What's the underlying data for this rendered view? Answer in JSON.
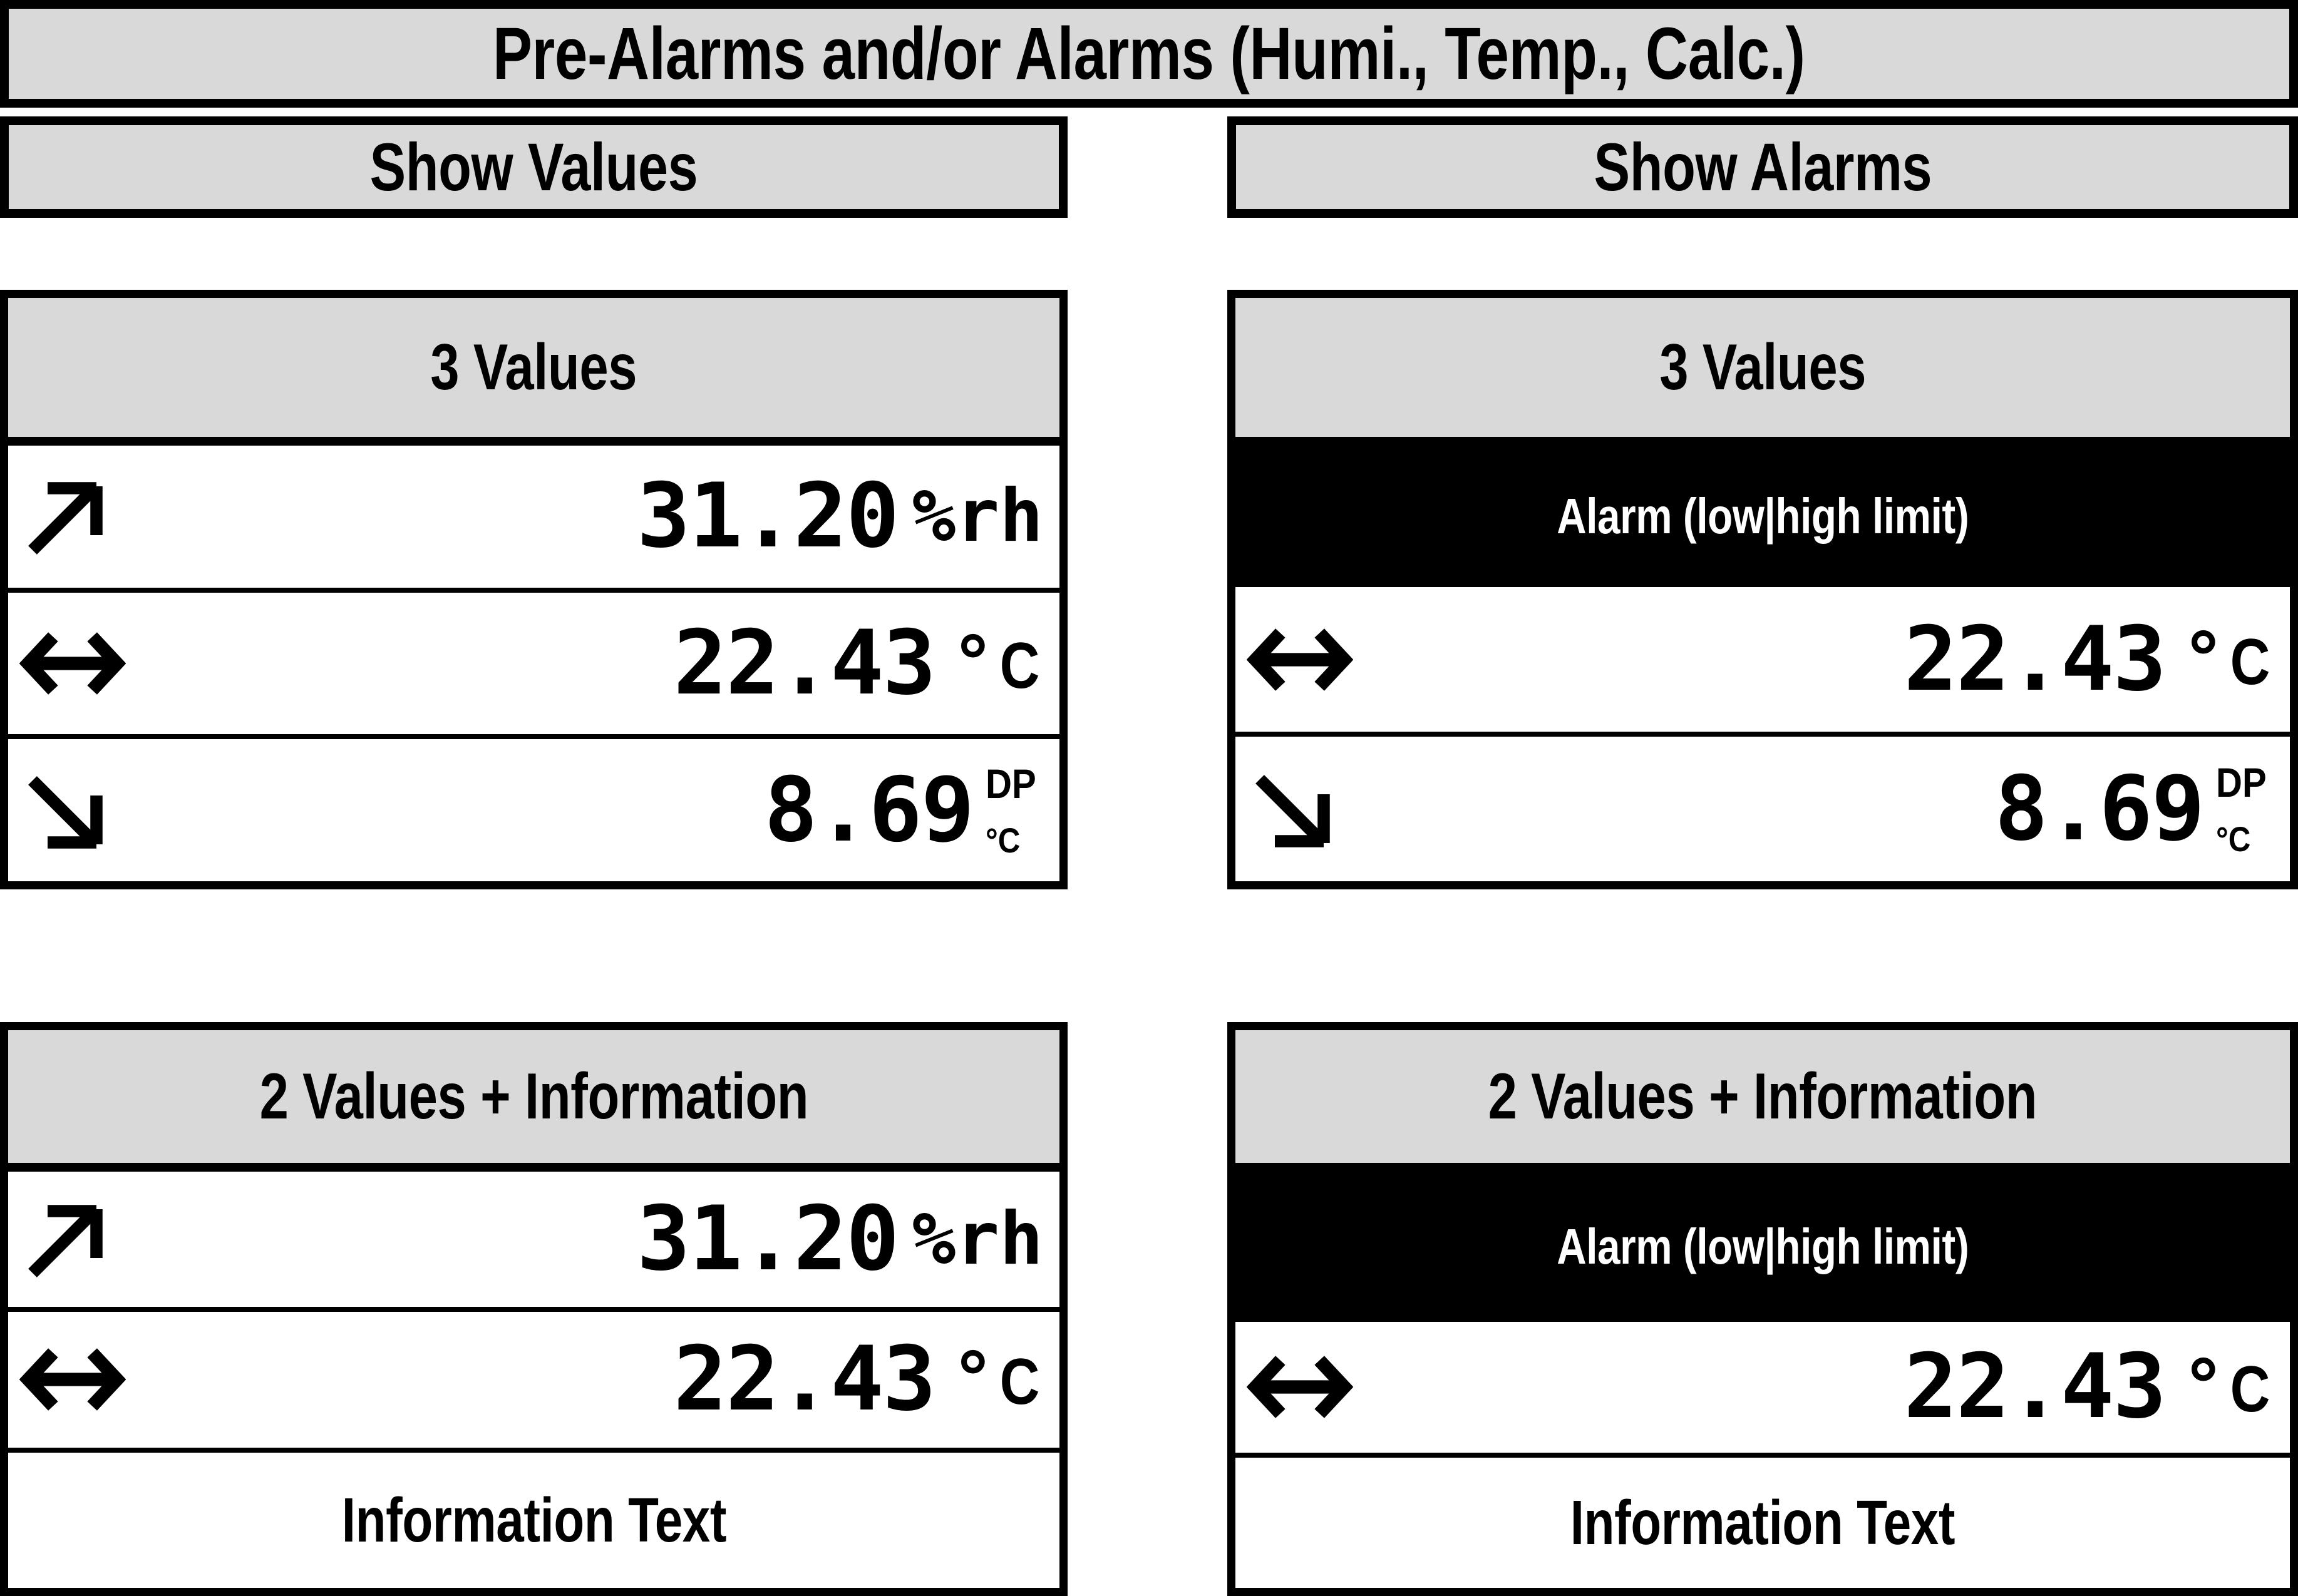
{
  "title": {
    "text": "Pre-Alarms and/or Alarms (Humi., Temp., Calc.)"
  },
  "columns": {
    "left_header": "Show Values",
    "right_header": "Show Alarms"
  },
  "colors": {
    "header_gray": "#D9D9D9",
    "border_black": "#000000",
    "alarm_background": "#000000",
    "alarm_text": "#FFFFFF",
    "panel_background": "#FFFFFF"
  },
  "icons": {
    "rising": "arrow-up-right-icon",
    "stable": "arrow-left-right-icon",
    "falling": "arrow-down-right-icon"
  },
  "alarm_label": "Alarm (low|high limit)",
  "information_text": "Information Text",
  "panels": {
    "top_left": {
      "title": "3 Values",
      "has_alarm_bar": false,
      "rows": [
        {
          "trend": "rising",
          "value": "31.20",
          "unit": "%rh",
          "unit_style": "mono"
        },
        {
          "trend": "stable",
          "value": "22.43",
          "unit": "°C",
          "unit_style": "degree",
          "deg_letter": "C"
        },
        {
          "trend": "falling",
          "value": "8.69",
          "unit": "DP °C",
          "unit_style": "stacked",
          "unit_top": "DP",
          "unit_bottom": "°C"
        }
      ],
      "information": null
    },
    "top_right": {
      "title": "3 Values",
      "has_alarm_bar": true,
      "alarm_label": "Alarm (low|high limit)",
      "rows": [
        {
          "trend": "stable",
          "value": "22.43",
          "unit": "°C",
          "unit_style": "degree",
          "deg_letter": "C"
        },
        {
          "trend": "falling",
          "value": "8.69",
          "unit": "DP °C",
          "unit_style": "stacked",
          "unit_top": "DP",
          "unit_bottom": "°C"
        }
      ],
      "information": null
    },
    "bottom_left": {
      "title": "2 Values + Information",
      "has_alarm_bar": false,
      "rows": [
        {
          "trend": "rising",
          "value": "31.20",
          "unit": "%rh",
          "unit_style": "mono"
        },
        {
          "trend": "stable",
          "value": "22.43",
          "unit": "°C",
          "unit_style": "degree",
          "deg_letter": "C"
        }
      ],
      "information": "Information Text"
    },
    "bottom_right": {
      "title": "2 Values + Information",
      "has_alarm_bar": true,
      "alarm_label": "Alarm (low|high limit)",
      "rows": [
        {
          "trend": "stable",
          "value": "22.43",
          "unit": "°C",
          "unit_style": "degree",
          "deg_letter": "C"
        }
      ],
      "information": "Information Text"
    }
  }
}
